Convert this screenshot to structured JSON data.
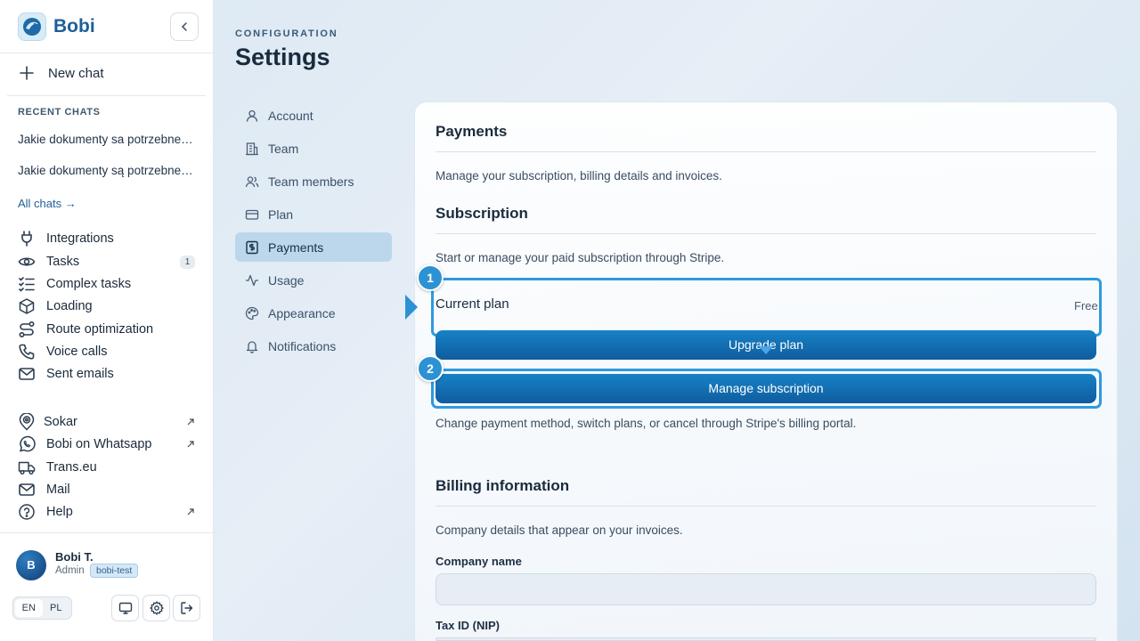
{
  "colors": {
    "brand": "#1c5f99",
    "accent": "#2d92d3",
    "button": "#1275b8",
    "active_nav": "#bcd7ec"
  },
  "sidebar": {
    "brand_name": "Bobi",
    "new_chat_label": "New chat",
    "recent_label": "RECENT CHATS",
    "recent_chats": [
      "Jakie dokumenty sa potrzebne do...",
      "Jakie dokumenty są potrzebne do..."
    ],
    "all_chats_label": "All chats →",
    "nav_items": [
      {
        "label": "Integrations",
        "icon": "plug-icon"
      },
      {
        "label": "Tasks",
        "icon": "eye-icon",
        "badge": "1"
      },
      {
        "label": "Complex tasks",
        "icon": "checklist-icon"
      },
      {
        "label": "Loading",
        "icon": "box-icon"
      },
      {
        "label": "Route optimization",
        "icon": "route-icon"
      },
      {
        "label": "Voice calls",
        "icon": "phone-icon"
      },
      {
        "label": "Sent emails",
        "icon": "mail-icon"
      }
    ],
    "link_items": [
      {
        "label": "Sokar",
        "icon": "location-icon",
        "external": true
      },
      {
        "label": "Bobi on Whatsapp",
        "icon": "whatsapp-icon",
        "external": true
      },
      {
        "label": "Trans.eu",
        "icon": "truck-icon",
        "external": false
      },
      {
        "label": "Mail",
        "icon": "mail-icon",
        "external": false
      },
      {
        "label": "Help",
        "icon": "help-icon",
        "external": true
      }
    ],
    "user": {
      "initial": "B",
      "name": "Bobi T.",
      "role": "Admin",
      "tag": "bobi-test"
    },
    "languages": [
      "EN",
      "PL"
    ],
    "active_language": "EN"
  },
  "main": {
    "eyebrow": "CONFIGURATION",
    "title": "Settings",
    "settings_nav": [
      {
        "label": "Account",
        "icon": "user-icon"
      },
      {
        "label": "Team",
        "icon": "building-icon"
      },
      {
        "label": "Team members",
        "icon": "users-icon"
      },
      {
        "label": "Plan",
        "icon": "card-icon"
      },
      {
        "label": "Payments",
        "icon": "receipt-icon",
        "active": true
      },
      {
        "label": "Usage",
        "icon": "activity-icon"
      },
      {
        "label": "Appearance",
        "icon": "palette-icon"
      },
      {
        "label": "Notifications",
        "icon": "bell-icon"
      }
    ],
    "payments": {
      "title": "Payments",
      "description": "Manage your subscription, billing details and invoices.",
      "subscription_title": "Subscription",
      "subscription_description": "Start or manage your paid subscription through Stripe.",
      "current_plan_label": "Current plan",
      "current_plan_value": "Free",
      "upgrade_label": "Upgrade plan",
      "manage_label": "Manage subscription",
      "manage_hint": "Change payment method, switch plans, or cancel through Stripe's billing portal.",
      "step_1": "1",
      "step_2": "2",
      "billing_title": "Billing information",
      "billing_description": "Company details that appear on your invoices.",
      "company_name_label": "Company name",
      "company_name_value": "",
      "tax_id_label": "Tax ID (NIP)",
      "tax_id_value": ""
    }
  }
}
